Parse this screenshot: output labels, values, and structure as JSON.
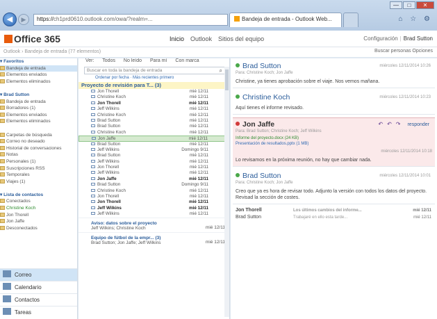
{
  "browser": {
    "address_host": "https://",
    "address_rest": "ch1prd0610.outlook.com/owa/?realm=...",
    "tab_active": "Bandeja de entrada - Outlook Web...",
    "tab_inactive": "",
    "win_buttons": [
      "—",
      "□",
      "✕"
    ],
    "tools": "⌂ ☆ ⚙"
  },
  "header": {
    "logo": "Office 365",
    "nav": [
      "Inicio",
      "Outlook",
      "Sitios del equipo"
    ],
    "right_left": "Configuración",
    "right_me": "Brad Sutton",
    "crumb": "Outlook › Bandeja de entrada (77 elementos)",
    "crumb_right": "Buscar personas    Opciones"
  },
  "folders": [
    {
      "label": "Favoritos",
      "type": "sec"
    },
    {
      "label": "Bandeja de entrada",
      "type": "sel"
    },
    {
      "label": "Elementos enviados",
      "type": "item"
    },
    {
      "label": "Elementos eliminados",
      "type": "item"
    },
    {
      "label": "",
      "type": "blank"
    },
    {
      "label": "Brad Sutton",
      "type": "sec"
    },
    {
      "label": "Bandeja de entrada",
      "type": "item"
    },
    {
      "label": "Borradores (1)",
      "type": "item"
    },
    {
      "label": "Elementos enviados",
      "type": "item"
    },
    {
      "label": "Elementos eliminados",
      "type": "item"
    },
    {
      "label": "",
      "type": "blank"
    },
    {
      "label": "Carpetas de búsqueda",
      "type": "item"
    },
    {
      "label": "Correo no deseado",
      "type": "item"
    },
    {
      "label": "Historial de conversaciones",
      "type": "item"
    },
    {
      "label": "Notas",
      "type": "item"
    },
    {
      "label": "Personales (1)",
      "type": "item"
    },
    {
      "label": "Suscripciones RSS",
      "type": "item"
    },
    {
      "label": "Temporales",
      "type": "item"
    },
    {
      "label": "Viajes (1)",
      "type": "item"
    },
    {
      "label": "",
      "type": "blank"
    },
    {
      "label": "Lista de contactos",
      "type": "sec"
    },
    {
      "label": "Conectados",
      "type": "item"
    },
    {
      "label": "Christine Koch",
      "type": "green"
    },
    {
      "label": "Jon Thorell",
      "type": "item"
    },
    {
      "label": "Jon Jaffe",
      "type": "item"
    },
    {
      "label": "Desconectados",
      "type": "item"
    },
    {
      "label": "",
      "type": "blank"
    }
  ],
  "bottom_nav": [
    "Correo",
    "Calendario",
    "Contactos",
    "Tareas"
  ],
  "list": {
    "headers": [
      "Ver:",
      "Todos",
      "No leído",
      "Para mí",
      "Con marca"
    ],
    "search_placeholder": "Buscar en toda la bandeja de entrada",
    "search_icon": "⌕",
    "filter_links": "Ordenar por fecha  ·  Más recientes primero",
    "conversation": "Proyecto de revisión para T...  (3)",
    "rows": [
      {
        "from": "Jon Thorell",
        "date": "mié 12/11",
        "type": "normal"
      },
      {
        "from": "Christine Koch",
        "date": "mié 12/11",
        "type": "normal"
      },
      {
        "from": "Jon Thorell",
        "date": "mié 12/11",
        "type": "unread"
      },
      {
        "from": "Jeff Wilkins",
        "date": "mié 12/11",
        "type": "normal"
      },
      {
        "from": "Christine Koch",
        "date": "mié 12/11",
        "type": "normal"
      },
      {
        "from": "Brad Sutton",
        "date": "mié 12/11",
        "type": "normal"
      },
      {
        "from": "Brad Sutton",
        "date": "mié 12/11",
        "type": "normal"
      },
      {
        "from": "Christine Koch",
        "date": "mié 12/11",
        "type": "normal"
      },
      {
        "from": "Jon Jaffe",
        "date": "mié 12/11",
        "type": "sel"
      },
      {
        "from": "Brad Sutton",
        "date": "mié 12/11",
        "type": "normal"
      },
      {
        "from": "Jeff Wilkins",
        "date": "Domingo 9/11",
        "type": "normal"
      },
      {
        "from": "Brad Sutton",
        "date": "mié 12/11",
        "type": "normal"
      },
      {
        "from": "Jeff Wilkins",
        "date": "mié 12/11",
        "type": "normal"
      },
      {
        "from": "Jon Thorell",
        "date": "mié 12/11",
        "type": "normal"
      },
      {
        "from": "Jeff Wilkins",
        "date": "mié 12/11",
        "type": "normal"
      },
      {
        "from": "Jon Jaffe",
        "date": "mié 12/11",
        "type": "unread"
      },
      {
        "from": "Brad Sutton",
        "date": "Domingo 9/11",
        "type": "normal"
      },
      {
        "from": "Christine Koch",
        "date": "mié 12/11",
        "type": "normal"
      },
      {
        "from": "Jon Thorell",
        "date": "mié 12/11",
        "type": "normal"
      },
      {
        "from": "Jon Thorell",
        "date": "mié 12/11",
        "type": "unread"
      },
      {
        "from": "Jeff Wilkins",
        "date": "mié 12/11",
        "type": "unread"
      },
      {
        "from": "Jeff Wilkins",
        "date": "mié 12/11",
        "type": "normal"
      }
    ],
    "block1_title": "Aviso: datos sobre el proyecto",
    "block1_sub": "Jeff Wilkins; Christine Koch",
    "block1_date": "mié 12/11",
    "block2_title": "Equipo de fútbol de la empr...  (3)",
    "block2_sub": "Brad Sutton; Jon Jaffe; Jeff Wilkins",
    "block2_date": "mié 12/11"
  },
  "reading": {
    "cards": [
      {
        "name": "Brad Sutton",
        "meta": "Para: Christine Koch; Jon Jaffe",
        "ts": "miércoles 12/11/2014 10:26",
        "body": "Christine, ya tienes aprobación sobre el viaje. Nos vemos mañana.",
        "style": "normal"
      },
      {
        "name": "Christine Koch",
        "meta": "",
        "ts": "miércoles 12/11/2014 10:23",
        "body": "Aquí tienes el informe revisado.",
        "style": "normal"
      },
      {
        "name": "Jon Jaffe",
        "meta": "Para: Brad Sutton; Christine Koch; Jeff Wilkins",
        "ts": "miércoles 12/11/2014 10:18",
        "body": "Lo revisamos en la próxima reunión, no hay que cambiar nada.",
        "style": "sel",
        "attach1": "Informe del proyecto.docx (24 KB)",
        "attach2": "Presentación de resultados.pptx (1 MB)",
        "reply": "responder"
      },
      {
        "name": "Brad Sutton",
        "meta": "Para: Christine Koch; Jon Jaffe",
        "ts": "miércoles 12/11/2014 10:01",
        "body": "Creo que ya es hora de revisar todo. Adjunto la versión con todos los datos del proyecto. Revisad la sección de costes.",
        "style": "normal"
      }
    ],
    "tail": [
      {
        "name": "Jon Thorell",
        "sub": "Los últimos cambios del informe...",
        "date": "mié 12/11"
      },
      {
        "name": "Brad Sutton",
        "sub": "Trabajaré en ello esta tarde...",
        "date": "mié 12/11"
      }
    ]
  }
}
